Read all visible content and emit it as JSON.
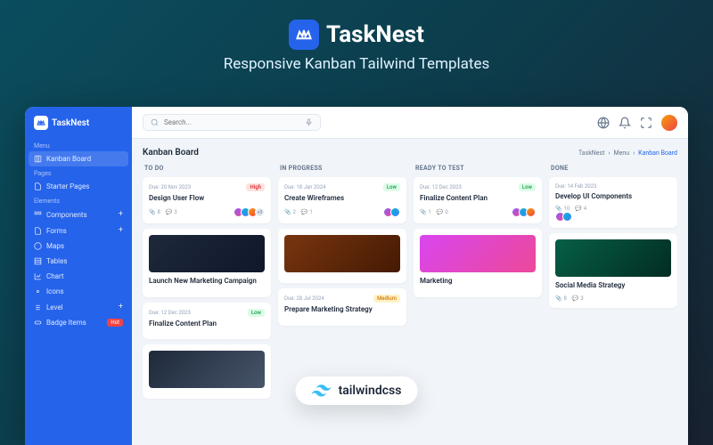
{
  "hero": {
    "title": "TaskNest",
    "subtitle": "Responsive Kanban Tailwind Templates"
  },
  "sidebar": {
    "title": "TaskNest",
    "sections": {
      "menu": "Menu",
      "pages": "Pages",
      "elements": "Elements"
    },
    "items": {
      "kanban": "Kanban Board",
      "starter": "Starter Pages",
      "components": "Components",
      "forms": "Forms",
      "maps": "Maps",
      "tables": "Tables",
      "chart": "Chart",
      "icons": "Icons",
      "level": "Level",
      "badge": "Badge Items"
    },
    "hot": "Hot"
  },
  "search": {
    "placeholder": "Search..."
  },
  "page": {
    "title": "Kanban Board"
  },
  "crumbs": {
    "root": "TaskNest",
    "mid": "Menu",
    "leaf": "Kanban Board"
  },
  "cols": {
    "todo": "TO DO",
    "prog": "IN PROGRESS",
    "ready": "READY TO TEST",
    "done": "DONE"
  },
  "cards": {
    "c1": {
      "due": "Due: 20 Nov 2023",
      "prio": "High",
      "title": "Design User Flow",
      "a": "8",
      "c": "3",
      "x": "+3"
    },
    "c2": {
      "due": "Due: 12 Dec 2023",
      "prio": "Low",
      "title": "Finalize Content Plan"
    },
    "c3": {
      "title": "Launch New Marketing Campaign"
    },
    "c4": {
      "due": "Due: 18 Jan 2024",
      "prio": "Low",
      "title": "Create Wireframes",
      "a": "2",
      "c": "1"
    },
    "c5": {
      "due": "Due: 28 Jul 2024",
      "prio": "Medium",
      "title": "Prepare Marketing Strategy"
    },
    "c6": {
      "due": "Due: 12 Dec 2023",
      "prio": "Low",
      "title": "Finalize Content Plan",
      "a": "1",
      "c": "0"
    },
    "c7": {
      "title": "Marketing"
    },
    "c8": {
      "due": "Due: 14 Feb 2023",
      "title": "Develop UI Components",
      "a": "10",
      "c": "4"
    },
    "c9": {
      "title": "Social Media Strategy",
      "a": "8",
      "c": "3"
    }
  },
  "tailwind": "tailwindcss"
}
